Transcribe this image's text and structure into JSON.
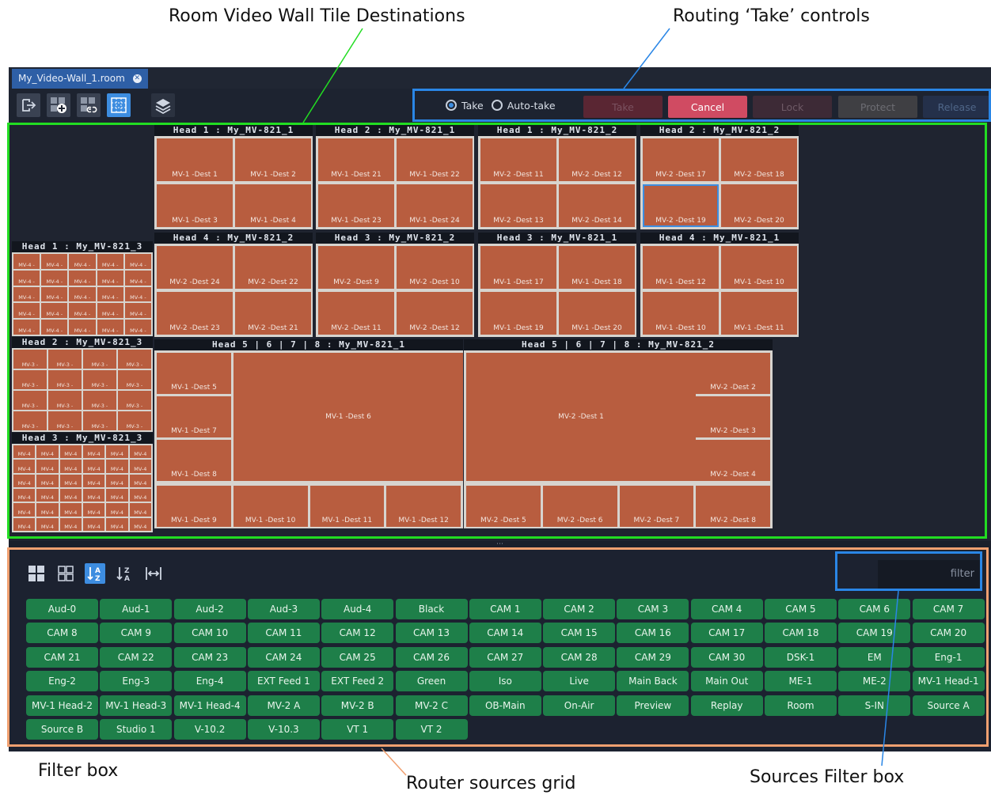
{
  "callouts": {
    "tile_destinations": "Room Video Wall Tile Destinations",
    "take_controls": "Routing ‘Take’ controls",
    "filter_box": "Filter box",
    "router_sources": "Router sources grid",
    "sources_filter": "Sources Filter box"
  },
  "tab": {
    "label": "My_Video-Wall_1.room"
  },
  "toolbar": {
    "icons": [
      "exit-icon",
      "add-tile-icon",
      "link-icon",
      "grid-icon",
      "layers-icon"
    ]
  },
  "take": {
    "take_label": "Take",
    "autotake_label": "Auto-take",
    "selected_mode": "Take",
    "buttons": [
      "Take",
      "Cancel",
      "Lock",
      "Protect",
      "Release"
    ]
  },
  "wall": {
    "heads_top": [
      {
        "label": "Head 1 : My_MV-821_1",
        "tiles": [
          "MV-1 -Dest 1",
          "MV-1 -Dest 2",
          "MV-1 -Dest 3",
          "MV-1 -Dest 4"
        ]
      },
      {
        "label": "Head 2 : My_MV-821_1",
        "tiles": [
          "MV-1 -Dest 21",
          "MV-1 -Dest 22",
          "MV-1 -Dest 23",
          "MV-1 -Dest 24"
        ]
      },
      {
        "label": "Head 1 : My_MV-821_2",
        "tiles": [
          "MV-2 -Dest 11",
          "MV-2 -Dest 12",
          "MV-2 -Dest 13",
          "MV-2 -Dest 14"
        ]
      },
      {
        "label": "Head 2 : My_MV-821_2",
        "tiles": [
          "MV-2 -Dest 17",
          "MV-2 -Dest 18",
          "MV-2 -Dest 19",
          "MV-2 -Dest 20"
        ]
      }
    ],
    "heads_mid": [
      {
        "label": "Head 4 : My_MV-821_2",
        "tiles": [
          "MV-2 -Dest 24",
          "MV-2 -Dest 22",
          "MV-2 -Dest 23",
          "MV-2 -Dest 21"
        ]
      },
      {
        "label": "Head 3 : My_MV-821_2",
        "tiles": [
          "MV-2 -Dest 9",
          "MV-2 -Dest 10",
          "MV-2 -Dest 11",
          "MV-2 -Dest 12"
        ]
      },
      {
        "label": "Head 3 : My_MV-821_1",
        "tiles": [
          "MV-1 -Dest 17",
          "MV-1 -Dest 18",
          "MV-1 -Dest 19",
          "MV-1 -Dest 20"
        ]
      },
      {
        "label": "Head 4 : My_MV-821_1",
        "tiles": [
          "MV-1 -Dest 12",
          "MV-1 -Dest 10",
          "MV-1 -Dest 10",
          "MV-1 -Dest 11"
        ]
      }
    ],
    "selected_tile": "MV-2 -Dest 19",
    "left_heads": [
      {
        "label": "Head 1 : My_MV-821_3",
        "tile_text": "MV-4 -"
      },
      {
        "label": "Head 2 : My_MV-821_3",
        "tile_text": "MV-3 -"
      },
      {
        "label": "Head 3 : My_MV-821_3",
        "tile_text": "MV-4"
      }
    ],
    "big_heads": [
      {
        "label": "Head 5 | 6 | 7 | 8 : My_MV-821_1",
        "side_tiles": [
          "MV-1 -Dest 5",
          "MV-1 -Dest 7",
          "MV-1 -Dest 8"
        ],
        "main_tile": "MV-1 -Dest 6",
        "bottom_tiles": [
          "MV-1 -Dest 9",
          "MV-1 -Dest 10",
          "MV-1 -Dest 11",
          "MV-1 -Dest 12"
        ]
      },
      {
        "label": "Head 5 | 6 | 7 | 8 : My_MV-821_2",
        "side_tiles": [
          "MV-2 -Dest 2",
          "MV-2 -Dest 3",
          "MV-2 -Dest 4"
        ],
        "main_tile": "MV-2 -Dest 1",
        "bottom_tiles": [
          "MV-2 -Dest 5",
          "MV-2 -Dest 6",
          "MV-2 -Dest 7",
          "MV-2 -Dest 8"
        ]
      }
    ]
  },
  "sources": {
    "filter_placeholder": "filter",
    "view_icons": [
      "large-grid-icon",
      "small-grid-icon",
      "sort-a-z-icon",
      "sort-z-a-icon",
      "fit-width-icon"
    ],
    "sort_selected": "sort-a-z-icon",
    "items": [
      "Aud-0",
      "Aud-1",
      "Aud-2",
      "Aud-3",
      "Aud-4",
      "Black",
      "CAM 1",
      "CAM 2",
      "CAM 3",
      "CAM 4",
      "CAM 5",
      "CAM 6",
      "CAM 7",
      "CAM 8",
      "CAM 9",
      "CAM 10",
      "CAM 11",
      "CAM 12",
      "CAM 13",
      "CAM 14",
      "CAM 15",
      "CAM 16",
      "CAM 17",
      "CAM 18",
      "CAM 19",
      "CAM 20",
      "CAM 21",
      "CAM 22",
      "CAM 23",
      "CAM 24",
      "CAM 25",
      "CAM 26",
      "CAM 27",
      "CAM 28",
      "CAM 29",
      "CAM 30",
      "DSK-1",
      "EM",
      "Eng-1",
      "Eng-2",
      "Eng-3",
      "Eng-4",
      "EXT Feed 1",
      "EXT Feed 2",
      "Green",
      "Iso",
      "Live",
      "Main Back",
      "Main Out",
      "ME-1",
      "ME-2",
      "MV-1 Head-1",
      "MV-1 Head-2",
      "MV-1 Head-3",
      "MV-1 Head-4",
      "MV-2 A",
      "MV-2 B",
      "MV-2 C",
      "OB-Main",
      "On-Air",
      "Preview",
      "Replay",
      "Room",
      "S-IN",
      "Source A",
      "Source B",
      "Studio 1",
      "V-10.2",
      "V-10.3",
      "VT 1",
      "VT 2"
    ]
  },
  "colors": {
    "tile": "#b85d3f",
    "source_button": "#1e7f49",
    "callout_green": "#22dd22",
    "callout_blue": "#2a86e6",
    "callout_orange": "#f0a070",
    "accent": "#3d8de0"
  }
}
